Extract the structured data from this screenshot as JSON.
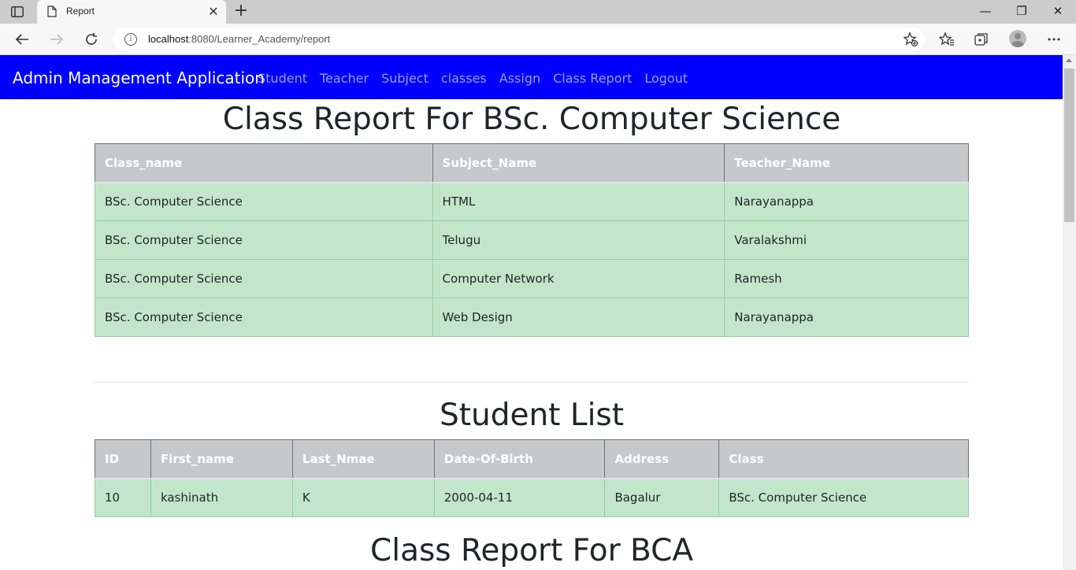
{
  "browser": {
    "tab_title": "Report",
    "url_host": "localhost",
    "url_rest": ":8080/Learner_Academy/report"
  },
  "navbar": {
    "brand": "Admin Management Application",
    "links": [
      "Student",
      "Teacher",
      "Subject",
      "classes",
      "Assign",
      "Class Report",
      "Logout"
    ]
  },
  "report1": {
    "title": "Class Report For BSc. Computer Science",
    "headers": [
      "Class_name",
      "Subject_Name",
      "Teacher_Name"
    ],
    "rows": [
      [
        "BSc. Computer Science",
        "HTML",
        "Narayanappa"
      ],
      [
        "BSc. Computer Science",
        "Telugu",
        "Varalakshmi"
      ],
      [
        "BSc. Computer Science",
        "Computer Network",
        "Ramesh"
      ],
      [
        "BSc. Computer Science",
        "Web Design",
        "Narayanappa"
      ]
    ]
  },
  "students1": {
    "title": "Student List",
    "headers": [
      "ID",
      "First_name",
      "Last_Nmae",
      "Date-Of-Birth",
      "Address",
      "Class"
    ],
    "rows": [
      [
        "10",
        "kashinath",
        "K",
        "2000-04-11",
        "Bagalur",
        "BSc. Computer Science"
      ]
    ]
  },
  "report2": {
    "title": "Class Report For BCA"
  },
  "colors": {
    "navbar_bg": "#0000ff",
    "header_bg": "#c6c8ca",
    "row_bg": "#c3e6cb"
  }
}
